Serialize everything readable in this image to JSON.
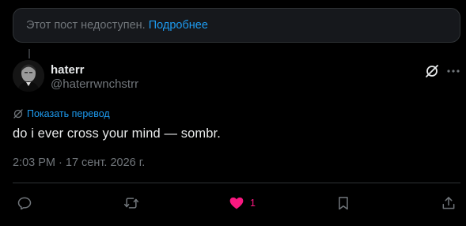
{
  "notice": {
    "text": "Этот пост недоступен.",
    "link": "Подробнее"
  },
  "author": {
    "display_name": "haterr",
    "handle": "@haterrwnchstrr"
  },
  "translate_label": "Показать перевод",
  "post": {
    "text": "do i ever cross your mind — sombr.",
    "timestamp": "2:03 PM · 17 сент. 2026 г."
  },
  "actions": {
    "like_count": "1"
  },
  "colors": {
    "accent": "#1d9bf0",
    "like": "#f91880",
    "muted": "#71767b",
    "text": "#e7e9ea"
  }
}
